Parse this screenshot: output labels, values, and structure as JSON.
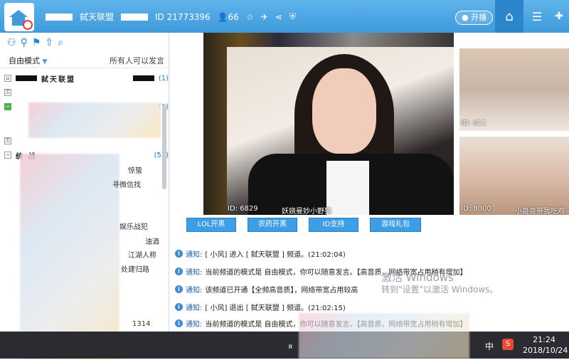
{
  "window": {
    "channel_name": "弑天联盟",
    "id_label": "ID 21773396",
    "online_count": "66",
    "kaibo_label": "开播"
  },
  "left": {
    "mode_label": "自由模式",
    "permission_label": "所有人可以发言",
    "tree": [
      {
        "name": "弑天联盟",
        "count": "(1)"
      },
      {
        "name": "",
        "count": "(1)"
      },
      {
        "name": "",
        "count": ""
      },
      {
        "name": "统 战",
        "count": "(53)"
      }
    ],
    "members": [
      "惊蛰",
      "寻微信找",
      "娱乐战犯",
      "油酒",
      "江湖人称",
      "处建归路",
      "1314"
    ]
  },
  "stage": {
    "main_id": "ID: 6829",
    "main_name": "妖娆曼妙小野猫",
    "cam1_id": "ID: 611",
    "cam2_id": "ID: 8000",
    "cam2_name": "小哥哥带我吃鸡"
  },
  "actions": [
    "LOL开黑",
    "农药开黑",
    "ID支持",
    "游戏礼包"
  ],
  "notices": [
    {
      "label": "通知:",
      "text": "[  小风] 进入 [     弑天联盟     ] 频道。(21:02:04)"
    },
    {
      "label": "通知:",
      "text": "当前频道的模式是 自由模式，你可以随意发言。【高音质，网络带宽占用稍有增加】"
    },
    {
      "label": "通知:",
      "text": "该频道已开通【全频高音质】，网络带宽占用较高"
    },
    {
      "label": "通知:",
      "text": "[  小风] 退出 [     弑天联盟     ] 频道。(21:02:15)"
    },
    {
      "label": "通知:",
      "text": "当前频道的模式是 自由模式，你可以随意发言。【高音质，网络带宽占用稍有增加】"
    }
  ],
  "watermark": {
    "line1": "激活 Windows",
    "line2": "转到\"设置\"以激活 Windows。"
  },
  "taskbar": {
    "ime": "中",
    "time": "21:24",
    "date": "2018/10/24",
    "app": "S",
    "r_label": "я"
  }
}
